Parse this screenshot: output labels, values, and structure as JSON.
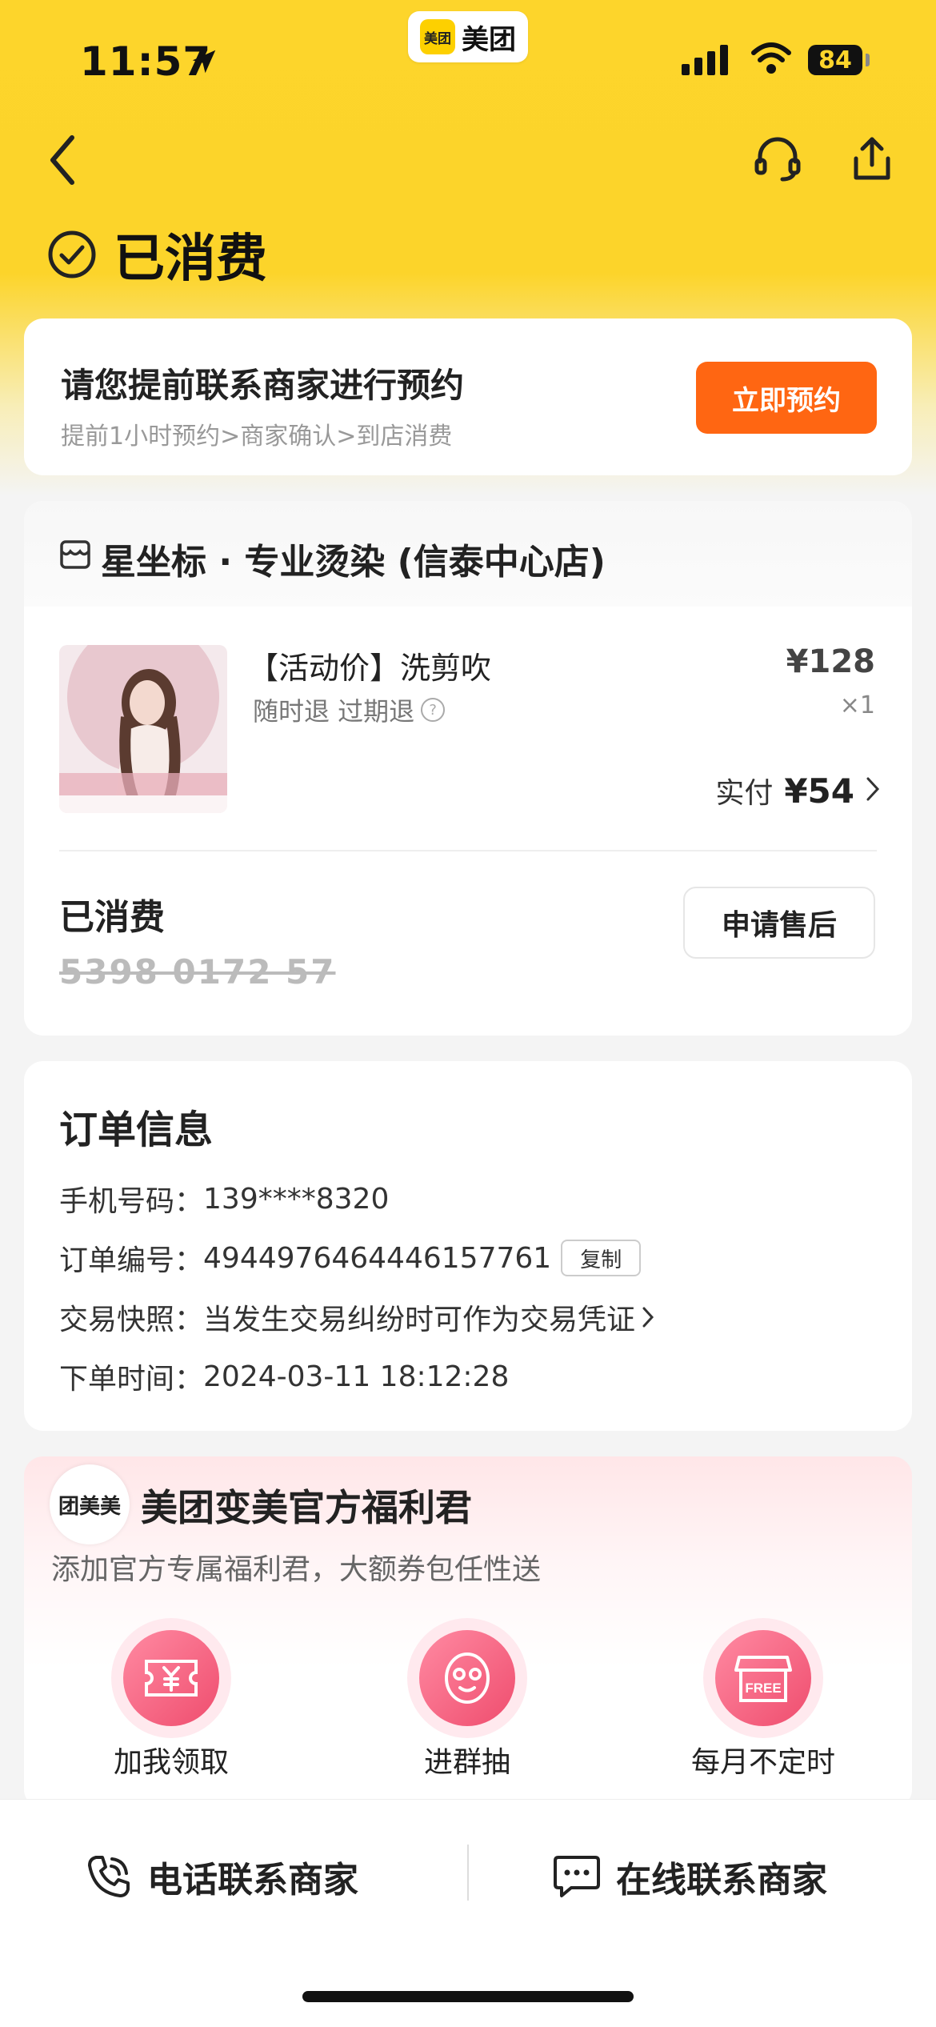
{
  "status_bar": {
    "time": "11:57",
    "app_name": "美团",
    "app_logo_text": "美团",
    "battery": "84"
  },
  "header": {
    "status_title": "已消费"
  },
  "reserve": {
    "title": "请您提前联系商家进行预约",
    "subtitle": "提前1小时预约>商家确认>到店消费",
    "button": "立即预约"
  },
  "order": {
    "store_name": "星坐标 · 专业烫染 (信泰中心店)",
    "product_title": "【活动价】洗剪吹",
    "product_tags": "随时退 过期退",
    "price": "¥128",
    "quantity": "×1",
    "paid_label": "实付",
    "paid_amount": "¥54",
    "consumed_label": "已消费",
    "coupon_code": "5398 0172 57",
    "after_sale_button": "申请售后"
  },
  "order_info": {
    "title": "订单信息",
    "phone_label": "手机号码：",
    "phone": "139****8320",
    "order_no_label": "订单编号：",
    "order_no": "4944976464446157761",
    "copy_button": "复制",
    "snapshot_label": "交易快照：",
    "snapshot_text": "当发生交易纠纷时可作为交易凭证",
    "time_label": "下单时间：",
    "time": "2024-03-11 18:12:28"
  },
  "promo": {
    "logo_text": "团美美",
    "title": "美团变美官方福利君",
    "subtitle": "添加官方专属福利君，大额券包任性送",
    "benefits": [
      {
        "label": "加我领取"
      },
      {
        "label": "进群抽"
      },
      {
        "label": "每月不定时"
      }
    ]
  },
  "bottom_bar": {
    "call_merchant": "电话联系商家",
    "chat_merchant": "在线联系商家"
  },
  "colors": {
    "brand_yellow": "#fdd52b",
    "accent_orange": "#ff6612",
    "promo_pink": "#ef4d6e"
  }
}
